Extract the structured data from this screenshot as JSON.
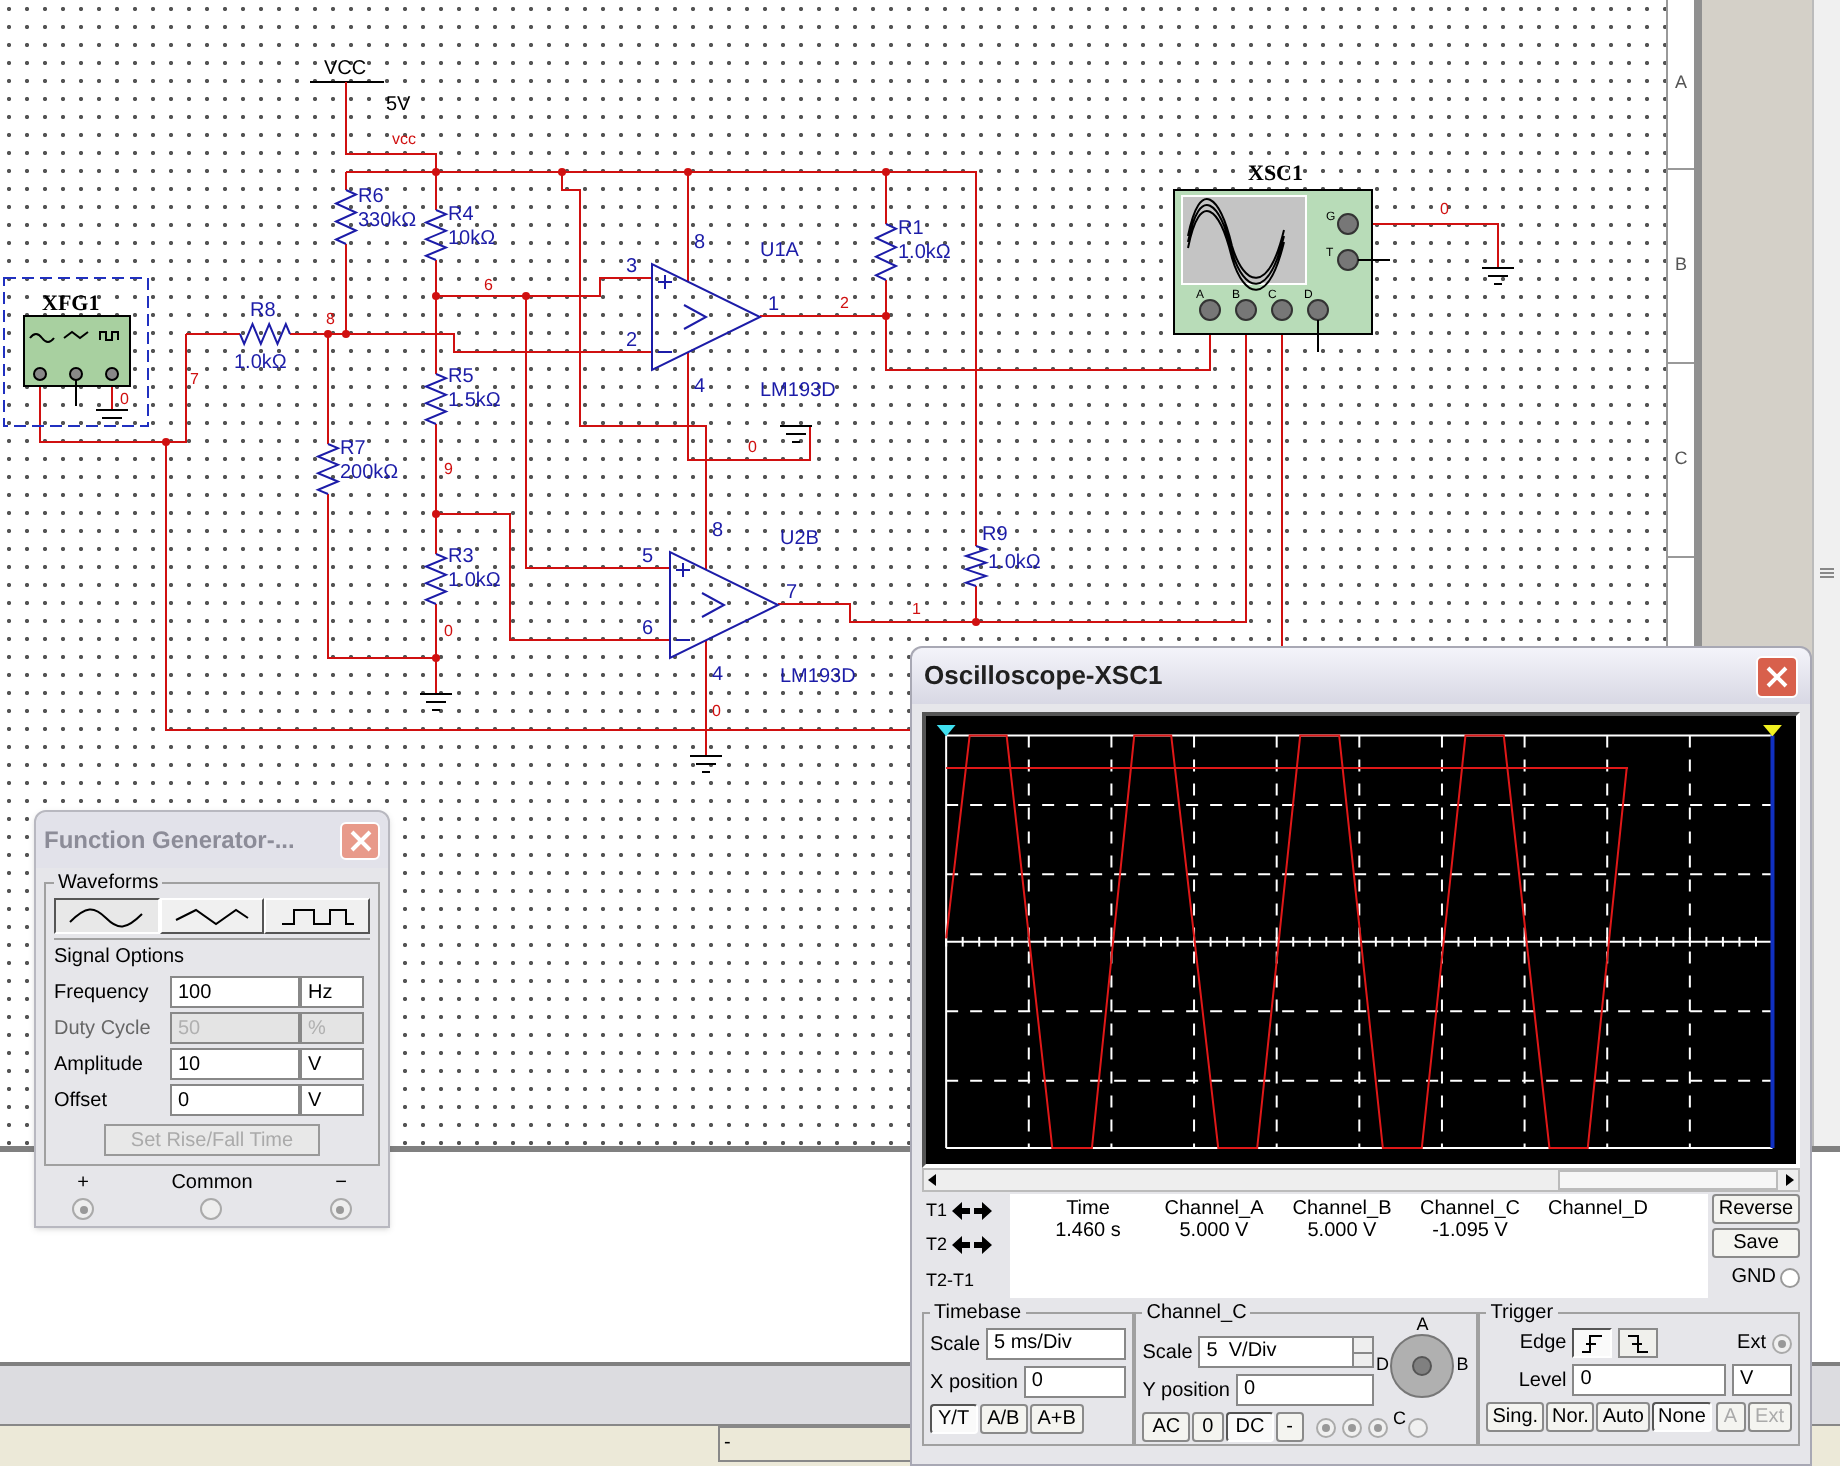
{
  "schematic": {
    "power": {
      "label": "VCC",
      "voltage": "5V"
    },
    "resistors": [
      {
        "ref": "R6",
        "value": "330kΩ"
      },
      {
        "ref": "R4",
        "value": "10kΩ"
      },
      {
        "ref": "R8",
        "value": "1.0kΩ"
      },
      {
        "ref": "R5",
        "value": "1.5kΩ"
      },
      {
        "ref": "R7",
        "value": "200kΩ"
      },
      {
        "ref": "R3",
        "value": "1.0kΩ"
      },
      {
        "ref": "R1",
        "value": "1.0kΩ"
      },
      {
        "ref": "R9",
        "value": "1.0kΩ"
      }
    ],
    "comparators": [
      {
        "ref": "U1A",
        "part": "LM193D",
        "pins": [
          "8",
          "3",
          "2",
          "1",
          "4"
        ]
      },
      {
        "ref": "U2B",
        "part": "LM193D",
        "pins": [
          "8",
          "5",
          "6",
          "7",
          "4"
        ]
      }
    ],
    "net_labels": [
      "vcc",
      "6",
      "8",
      "7",
      "0",
      "9",
      "0",
      "2",
      "0",
      "1",
      "0",
      "0"
    ],
    "function_generator_symbol": {
      "ref": "XFG1"
    },
    "oscilloscope_symbol": {
      "ref": "XSC1",
      "terminals": [
        "A",
        "B",
        "C",
        "D"
      ],
      "side_terminals": [
        "G",
        "T"
      ]
    },
    "border_labels": [
      "A",
      "B",
      "C"
    ]
  },
  "function_generator": {
    "title": "Function Generator-...",
    "waveforms_label": "Waveforms",
    "waveforms": [
      {
        "kind": "sine",
        "selected": true
      },
      {
        "kind": "triangle",
        "selected": false
      },
      {
        "kind": "square",
        "selected": false
      }
    ],
    "signal_options_label": "Signal Options",
    "fields": [
      {
        "label": "Frequency",
        "value": "100",
        "unit": "Hz",
        "disabled": false
      },
      {
        "label": "Duty Cycle",
        "value": "50",
        "unit": "%",
        "disabled": true
      },
      {
        "label": "Amplitude",
        "value": "10",
        "unit": "V",
        "disabled": false
      },
      {
        "label": "Offset",
        "value": "0",
        "unit": "V",
        "disabled": false
      }
    ],
    "rise_fall_button": {
      "label": "Set Rise/Fall Time",
      "disabled": true
    },
    "terminals": [
      {
        "label": "+",
        "checked": true
      },
      {
        "label": "Common",
        "checked": false
      },
      {
        "label": "−",
        "checked": true
      }
    ]
  },
  "oscilloscope": {
    "title": "Oscilloscope-XSC1",
    "cursor_rows": [
      {
        "label": "T1",
        "kind": "cursor"
      },
      {
        "label": "T2",
        "kind": "cursor"
      },
      {
        "label": "T2-T1",
        "kind": "difference"
      }
    ],
    "readout_columns": [
      "Time",
      "Channel_A",
      "Channel_B",
      "Channel_C",
      "Channel_D"
    ],
    "readout_values": [
      "1.460 s",
      "5.000 V",
      "5.000 V",
      "-1.095 V"
    ],
    "side_buttons": [
      "Reverse",
      "Save"
    ],
    "gnd_label": "GND",
    "gnd_checked": false,
    "timebase": {
      "title": "Timebase",
      "scale_label": "Scale",
      "scale": "5 ms/Div",
      "xpos_label": "X position",
      "xpos": "0",
      "modes": [
        {
          "label": "Y/T",
          "selected": true
        },
        {
          "label": "A/B",
          "selected": false
        },
        {
          "label": "A+B",
          "selected": false
        }
      ]
    },
    "channel": {
      "title": "Channel_C",
      "scale_label": "Scale",
      "scale": "5  V/Div",
      "ypos_label": "Y position",
      "ypos": "0",
      "coupling": [
        {
          "label": "AC",
          "selected": false
        },
        {
          "label": "0",
          "selected": false
        },
        {
          "label": "DC",
          "selected": true
        },
        {
          "label": "-",
          "selected": false
        }
      ],
      "knob_labels": [
        "A",
        "B",
        "C",
        "D"
      ],
      "probe_radios": [
        {
          "checked": true
        },
        {
          "checked": true
        },
        {
          "checked": true
        },
        {
          "checked": false
        }
      ]
    },
    "trigger": {
      "title": "Trigger",
      "edge_label": "Edge",
      "edges": [
        {
          "kind": "rising",
          "selected": true
        },
        {
          "kind": "falling",
          "selected": false
        }
      ],
      "ext_label": "Ext",
      "ext_checked": true,
      "level_label": "Level",
      "level": "0",
      "level_unit": "V",
      "modes": [
        {
          "label": "Sing.",
          "selected": false
        },
        {
          "label": "Nor.",
          "selected": false
        },
        {
          "label": "Auto",
          "selected": false
        },
        {
          "label": "None",
          "selected": true
        }
      ],
      "sources": [
        {
          "label": "A",
          "disabled": true
        },
        {
          "label": "Ext",
          "disabled": true
        }
      ]
    }
  },
  "status_bar": {
    "cell": "-"
  }
}
